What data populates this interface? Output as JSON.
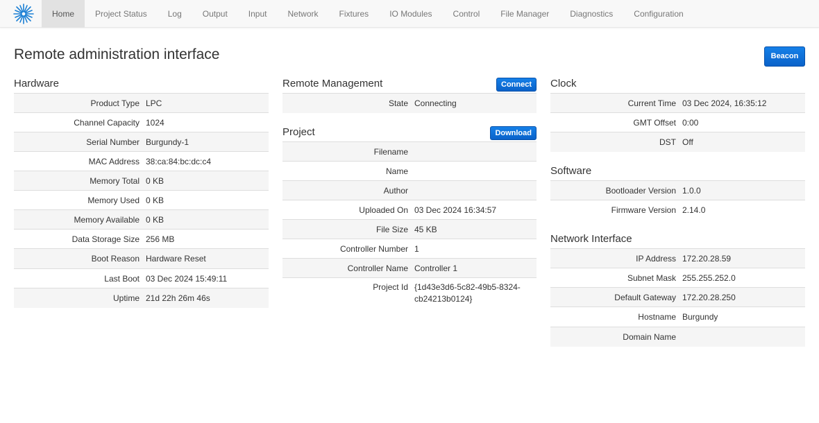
{
  "nav": {
    "logo_icon": "starburst-logo-icon",
    "items": [
      "Home",
      "Project Status",
      "Log",
      "Output",
      "Input",
      "Network",
      "Fixtures",
      "IO Modules",
      "Control",
      "File Manager",
      "Diagnostics",
      "Configuration"
    ],
    "active": "Home"
  },
  "page": {
    "title": "Remote administration interface",
    "beacon_label": "Beacon"
  },
  "hardware": {
    "title": "Hardware",
    "rows": [
      {
        "key": "Product Type",
        "value": "LPC"
      },
      {
        "key": "Channel Capacity",
        "value": "1024"
      },
      {
        "key": "Serial Number",
        "value": "Burgundy-1"
      },
      {
        "key": "MAC Address",
        "value": "38:ca:84:bc:dc:c4"
      },
      {
        "key": "Memory Total",
        "value": "0 KB"
      },
      {
        "key": "Memory Used",
        "value": "0 KB"
      },
      {
        "key": "Memory Available",
        "value": "0 KB"
      },
      {
        "key": "Data Storage Size",
        "value": "256 MB"
      },
      {
        "key": "Boot Reason",
        "value": "Hardware Reset"
      },
      {
        "key": "Last Boot",
        "value": "03 Dec 2024 15:49:11"
      },
      {
        "key": "Uptime",
        "value": "21d 22h 26m 46s"
      }
    ]
  },
  "remote": {
    "title": "Remote Management",
    "button_label": "Connect",
    "rows": [
      {
        "key": "State",
        "value": "Connecting"
      }
    ]
  },
  "project": {
    "title": "Project",
    "button_label": "Download",
    "rows": [
      {
        "key": "Filename",
        "value": ""
      },
      {
        "key": "Name",
        "value": ""
      },
      {
        "key": "Author",
        "value": ""
      },
      {
        "key": "Uploaded On",
        "value": "03 Dec 2024 16:34:57"
      },
      {
        "key": "File Size",
        "value": "45 KB"
      },
      {
        "key": "Controller Number",
        "value": "1"
      },
      {
        "key": "Controller Name",
        "value": "Controller 1"
      },
      {
        "key": "Project Id",
        "value": "{1d43e3d6-5c82-49b5-8324-cb24213b0124}"
      }
    ]
  },
  "clock": {
    "title": "Clock",
    "rows": [
      {
        "key": "Current Time",
        "value": "03 Dec 2024, 16:35:12"
      },
      {
        "key": "GMT Offset",
        "value": "0:00"
      },
      {
        "key": "DST",
        "value": "Off"
      }
    ]
  },
  "software": {
    "title": "Software",
    "rows": [
      {
        "key": "Bootloader Version",
        "value": "1.0.0"
      },
      {
        "key": "Firmware Version",
        "value": "2.14.0"
      }
    ]
  },
  "network_interface": {
    "title": "Network Interface",
    "rows": [
      {
        "key": "IP Address",
        "value": "172.20.28.59"
      },
      {
        "key": "Subnet Mask",
        "value": "255.255.252.0"
      },
      {
        "key": "Default Gateway",
        "value": "172.20.28.250"
      },
      {
        "key": "Hostname",
        "value": "Burgundy"
      },
      {
        "key": "Domain Name",
        "value": ""
      }
    ]
  },
  "colors": {
    "accent": "#0d6bd6",
    "navbar_bg": "#f8f8f8",
    "active_tab_bg": "#e2e2e2",
    "stripe": "#f5f5f5"
  }
}
